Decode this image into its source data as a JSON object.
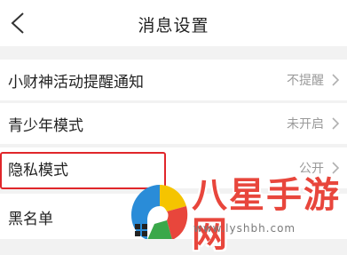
{
  "header": {
    "title": "消息设置",
    "back_icon": "chevron-left-icon"
  },
  "rows": [
    {
      "label": "小财神活动提醒通知",
      "value": "不提醒"
    },
    {
      "label": "青少年模式",
      "value": "未开启"
    },
    {
      "label": "隐私模式",
      "value": "公开"
    },
    {
      "label": "黑名单",
      "value": ""
    }
  ],
  "watermark": {
    "text": "八星手游网",
    "url": "www.lyshbh.com",
    "color": "#e8463c"
  },
  "colors": {
    "highlight": "#e0262a",
    "background": "#f2f2f2"
  }
}
